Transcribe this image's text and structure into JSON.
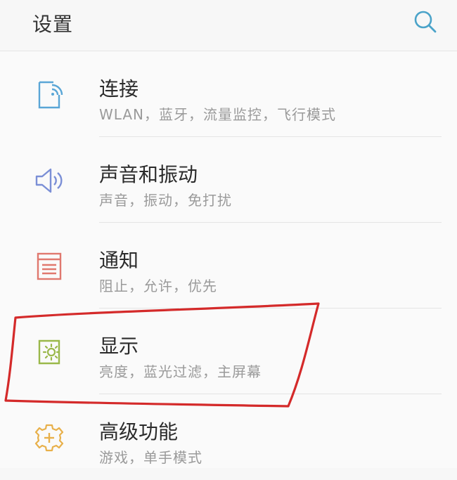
{
  "header": {
    "title": "设置",
    "search_icon": "search-icon"
  },
  "colors": {
    "connect": "#5aa6d6",
    "sound": "#7b8fd6",
    "notify": "#e0786e",
    "display": "#9ab84a",
    "advanced": "#e8b04a",
    "annotation": "#d42a2a"
  },
  "items": [
    {
      "title": "连接",
      "subtitle": "WLAN，蓝牙，流量监控，飞行模式",
      "icon": "connection-icon"
    },
    {
      "title": "声音和振动",
      "subtitle": "声音，振动，免打扰",
      "icon": "speaker-icon"
    },
    {
      "title": "通知",
      "subtitle": "阻止，允许，优先",
      "icon": "notification-icon"
    },
    {
      "title": "显示",
      "subtitle": "亮度，蓝光过滤，主屏幕",
      "icon": "display-brightness-icon"
    },
    {
      "title": "高级功能",
      "subtitle": "游戏，单手模式",
      "icon": "gear-plus-icon"
    }
  ]
}
